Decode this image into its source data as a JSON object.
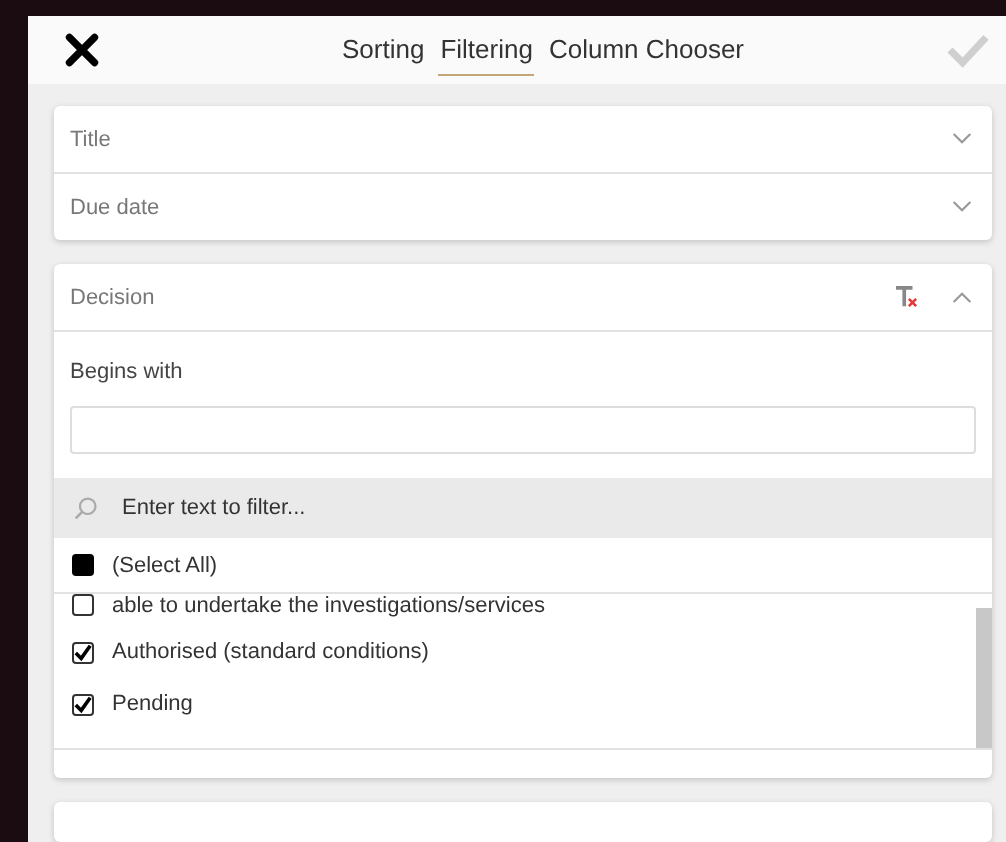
{
  "tabs": [
    {
      "label": "Sorting",
      "selected": false
    },
    {
      "label": "Filtering",
      "selected": true
    },
    {
      "label": "Column Chooser",
      "selected": false
    }
  ],
  "columns": [
    {
      "label": "Title",
      "expanded": false
    },
    {
      "label": "Due date",
      "expanded": false
    }
  ],
  "filter": {
    "column": "Decision",
    "expanded": true,
    "operator": "Begins with",
    "search": {
      "placeholder": "Enter text to filter..."
    },
    "select_all": {
      "label": "(Select All)",
      "checked": false,
      "indeterminate": true
    },
    "options": [
      {
        "label": "able to undertake the investigations/services",
        "checked": false
      },
      {
        "label": "Authorised (standard conditions)",
        "checked": true
      },
      {
        "label": "Pending",
        "checked": true
      }
    ]
  }
}
